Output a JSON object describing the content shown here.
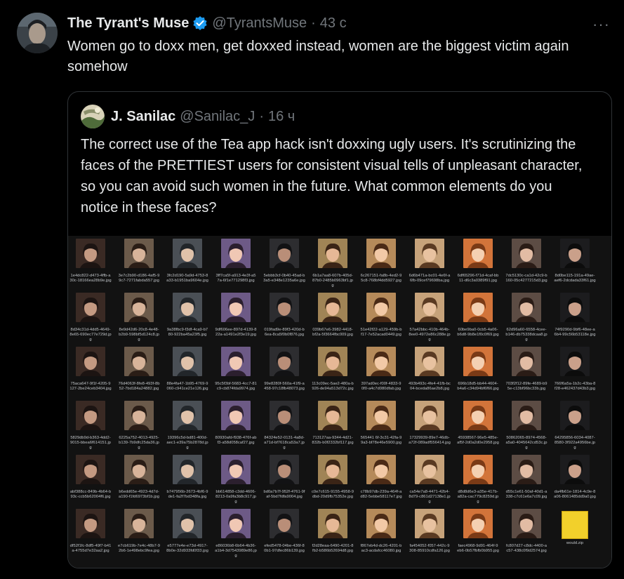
{
  "tweet": {
    "name": "The Tyrant's Muse",
    "handle": "@TyrantsMuse",
    "separator": "·",
    "time": "43 с",
    "more_icon": "more-horizontal-icon",
    "verified_icon": "verified-badge-icon",
    "text": "Women go to doxx men, get doxxed instead, women are the biggest victim again somehow"
  },
  "quote": {
    "name": "J. Sanilac",
    "handle": "@Sanilac_J",
    "separator": "·",
    "time": "16 ч",
    "text": "The correct use of the Tea app hack isn't doxxing ugly users. It's scrutinizing the faces of the PRETTIEST users for consistent visual tells of unpleasant character, so you can avoid such women in the future. What common elements do you notice in these faces?"
  },
  "file_grid": {
    "rows": [
      [
        "1e4dc822-d473-4ffb-a30c-18166ea28b9e.jpg",
        "3e7c2b90-d186-4af5-99c7-7271fabda557.jpg",
        "3fc2d190-5a9d-4753-8a33-b1951ba9604e.jpg",
        "3ff7ca5f-a913-4e3f-a57a-6f1e771298f3.jpg",
        "5ebbb3cf-0b40-45ad-b3a5-e348e1235a6e.jpg",
        "6b1a7aa8-607b-405d-87b0-2485b0963bf1.jpg",
        "6c267151-fa8b-4ed2-95c8-768bf4dd5927.jpg",
        "6d6b471a-bc01-4e6f-a6fb-09cef79698ba.jpg",
        "6df65296-f71d-4caf-bb11-d6c3a0389f91.jpg",
        "7dc5130c-ca1d-42c9-b160-05c4277215d3.jpg",
        "8d0be115-191a-49ae-aef6-2dcdada33f61.jpg"
      ],
      [
        "8d34c31d-4dd5-4649-8e65-690ec77e729d.jpg",
        "8e9d42d6-20c8-4e48-b2b9-598bf5d124c8.jpg",
        "9a38fbc9-f3df-4ca9-b780-922ba45a23f5.jpg",
        "9df606ee-897d-4139-822a-a1491e2f3e19.jpg",
        "019fad9e-89f3-420d-b6ea-8ca5f0b0f876.jpg",
        "039b67e6-3982-4418-bf2a-5f3664fbc009.jpg",
        "51e42f22-a129-459b-bf17-7e52acad0449.jpg",
        "57a42bbc-410b-464b-8ee0-4972e86c288e.jpg",
        "60be9ba0-0cb5-4a06-b6d8-9b8e1f0c0f69.jpg",
        "62d96a60-6558-4cee-b146-db75338dcaa8.jpg",
        "74f9290d-9bf6-48ee-a6b4-99c56b53118e.jpg"
      ],
      [
        "75aca647-9f1f-4205-9127-2be24ceb3404.jpg",
        "76d4063f-8fe8-493f-8b52-7bd184a24882.jpg",
        "88e4fa47-1b95-4769-9060-c941ce21e126.jpg",
        "95c5f3bf-5683-4cc7-81c9-cb874fda9974.jpg",
        "99e8280f-560a-41f9-a458-97c18fb48073.jpg",
        "113c09ec-5ae2-480a-b926-de94a513d72c.jpg",
        "397ad0ec-f00f-4833-90f0-a4c7d080dfab.jpg",
        "493b493c-4fe4-41fb-bc04-bceda86ae2b8.jpg",
        "696b18d5-bb44-4604-b4a6-c34d94bf6f66.jpg",
        "703f2f12-89fe-4689-b95e-c13bf96bc33b.jpg",
        "766f6a5a-1b2c-43ba-8f28-e462437d43b3.jpg"
      ],
      [
        "5829db9d-b363-4dd2-9015-bbea6f614151.jpg",
        "6225a752-4013-4925-b139-7b9dfc25da36.jpg",
        "19396c5d-bd81-400d-aec1-e39a75b2878d.jpg",
        "80930afd-f938-476f-abf3-a58d058caf27.jpg",
        "84324e52-0131-4a8d-a71d-bf7618ca53a7.jpg",
        "713127aa-9344-4d21-832b-b0f2332bf117.jpg",
        "565441 6f-3c31-42fa-99a3-bf78e46e5900.jpg",
        "17329939-89e7-46db-a72f-089adf556414.jpg",
        "45938567-96e5-485e-af5f-2d0a2d0e2958.jpg",
        "50862065-8974-4568-a5a0-4045642cd53c.jpg",
        "64295856-6034-4087-8580-3f922a4956be.jpg"
      ],
      [
        "abf388cc-849b-4b64-b93c-ccb5b62004f6.jpg",
        "b6edd65e-4923-4d7d-a190-f1fd6973bf1b.jpg",
        "b747956b-2673-4bf6-9de1-fa2f7bd348fa.jpg",
        "bb614858-c3dd-4606-8213-0a9fa3b8c917.jpg",
        "bd0a7b7f-952f-4761-9faf-5bd7fdfa9004.jpg",
        "c0e7c615-9155-4958-9dbd-20d9fb75352e.jpg",
        "c78b97db-239a-464f-ad82-5ebbe58117e7.jpg",
        "ca54e7a8-4471-42b4-8d79-c861d27138e1.jpg",
        "d8d8d6e3-a35e-417b-a82a-cac779c8259d.jpg",
        "d55c1e61-50af-40d1-a338-c7c61e6a7c09.jpg",
        "da4fb61e-1814-4c9e-8a06-8061485dd9a0.jpg"
      ],
      [
        "df52f1fc-8df5-49f7-b41a-4755d7e32aa2.jpg",
        "e7cb619b-7e4c-48b7-92b6-1e498ebc9fea.jpg",
        "e5777e4e-e73d-4917-8b0e-32d933fd0f33.jpg",
        "e86036b8-6b64-4b36-a1b4-3d7543989e86.jpg",
        "efed5478-04be-436f-80b1-97dfec86b139.jpg",
        "f2d28eaa-6490-4201-8fb2-b586b52694d8.jpg",
        "f867eb4d-dc26-4201-bac3-acdafcc46080.jpg",
        "fa454052-f057-442c-9308-85910cdfa126.jpg",
        "faec4968-9d91-464f-9eb6-0b57fbfb0b955.jpg",
        "fc807d27-c8dc-4400-ac57-438c0f9d2574.jpg",
        "would.zip"
      ]
    ]
  }
}
